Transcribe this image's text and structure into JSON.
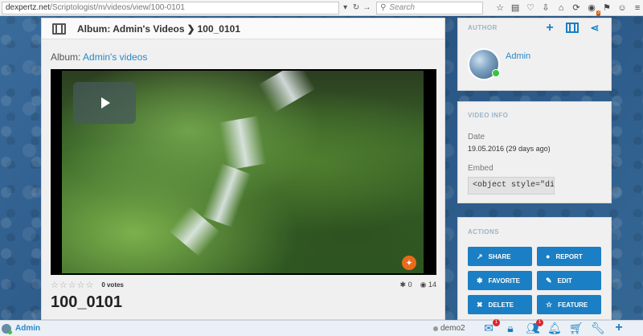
{
  "browser": {
    "url_host": "dexpertz.net",
    "url_path": "/Scriptologist/m/videos/view/100-0101",
    "search_placeholder": "Search",
    "toolbar_badge": "3"
  },
  "header": {
    "breadcrumb_album": "Album: Admin's Videos",
    "breadcrumb_sep": "❯",
    "breadcrumb_current": "100_0101"
  },
  "main": {
    "album_label": "Album:",
    "album_link": "Admin's videos",
    "stars": "☆☆☆☆☆",
    "votes": "0 votes",
    "favorites_count": "0",
    "views_count": "14",
    "title": "100_0101",
    "video_logo_icon": "globe-logo-icon"
  },
  "owner_panel": {
    "heading": "AUTHOR",
    "name": "Admin"
  },
  "info_panel": {
    "heading": "VIDEO INFO",
    "date_label": "Date",
    "date_value": "19.05.2016 (29 days ago)",
    "embed_label": "Embed",
    "embed_value": "<object style=\"di"
  },
  "actions_panel": {
    "heading": "ACTIONS",
    "share": "SHARE",
    "report": "REPORT",
    "favorite": "FAVORITE",
    "edit": "EDIT",
    "delete": "DELETE",
    "feature": "FEATURE"
  },
  "bottom_bar": {
    "user": "Admin",
    "other_user": "demo2",
    "mail_badge": "1",
    "friends_badge": "1"
  },
  "colors": {
    "accent": "#1a7fc4",
    "link": "#2a87c8",
    "online": "#35c53a",
    "badge": "#d9262c"
  }
}
